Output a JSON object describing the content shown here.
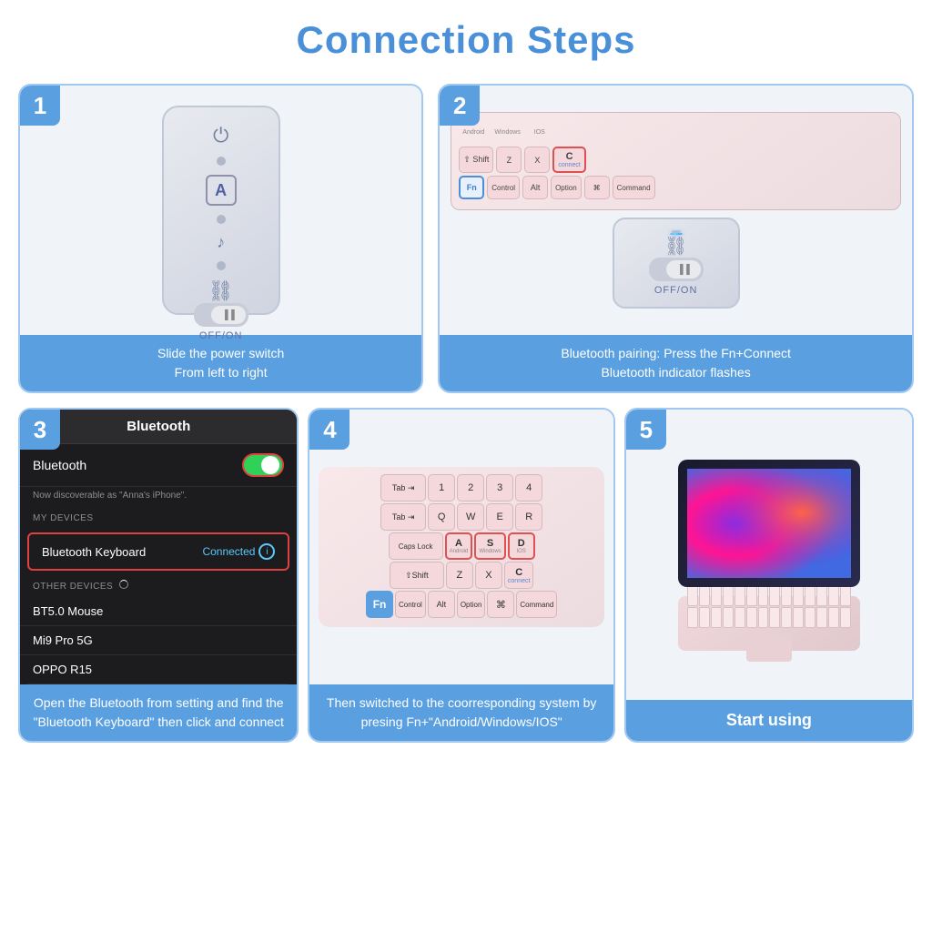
{
  "title": "Connection Steps",
  "steps": [
    {
      "number": "1",
      "caption": "Slide the power switch\nFrom left to right"
    },
    {
      "number": "2",
      "caption": "Bluetooth pairing: Press the Fn+Connect\nBluetooth indicator flashes"
    },
    {
      "number": "3",
      "caption": "Open the Bluetooth from setting and find the \"Bluetooth Keyboard\" then click and connect"
    },
    {
      "number": "4",
      "caption": "Then switched to the coorresponding system by presing Fn+\"Android/Windows/IOS\""
    },
    {
      "number": "5",
      "caption": "Start using"
    }
  ],
  "bluetooth_panel": {
    "header": "Bluetooth",
    "toggle_label": "Bluetooth",
    "discoverable_text": "Now discoverable as \"Anna's iPhone\".",
    "my_devices": "MY DEVICES",
    "device_name": "Bluetooth Keyboard",
    "connected_text": "Connected",
    "other_devices": "OTHER DEVICES",
    "other1": "BT5.0 Mouse",
    "other2": "Mi9 Pro 5G",
    "other3": "OPPO R15"
  },
  "keyboard": {
    "row1": [
      "1",
      "2",
      "3",
      "4"
    ],
    "row2": [
      "Q",
      "W",
      "E",
      "R"
    ],
    "row3_left": "Caps Lock",
    "row3_keys": [
      "A",
      "S",
      "D"
    ],
    "row3_os": [
      "Android",
      "Windows",
      "IOS"
    ],
    "row4": [
      "Z",
      "X",
      "C"
    ],
    "connect": "connect",
    "shift": "⇧Shift",
    "fn": "Fn",
    "control": "Control",
    "alt": "Alt",
    "option": "Option",
    "command": "Command",
    "tab": "Tab ⇥"
  }
}
